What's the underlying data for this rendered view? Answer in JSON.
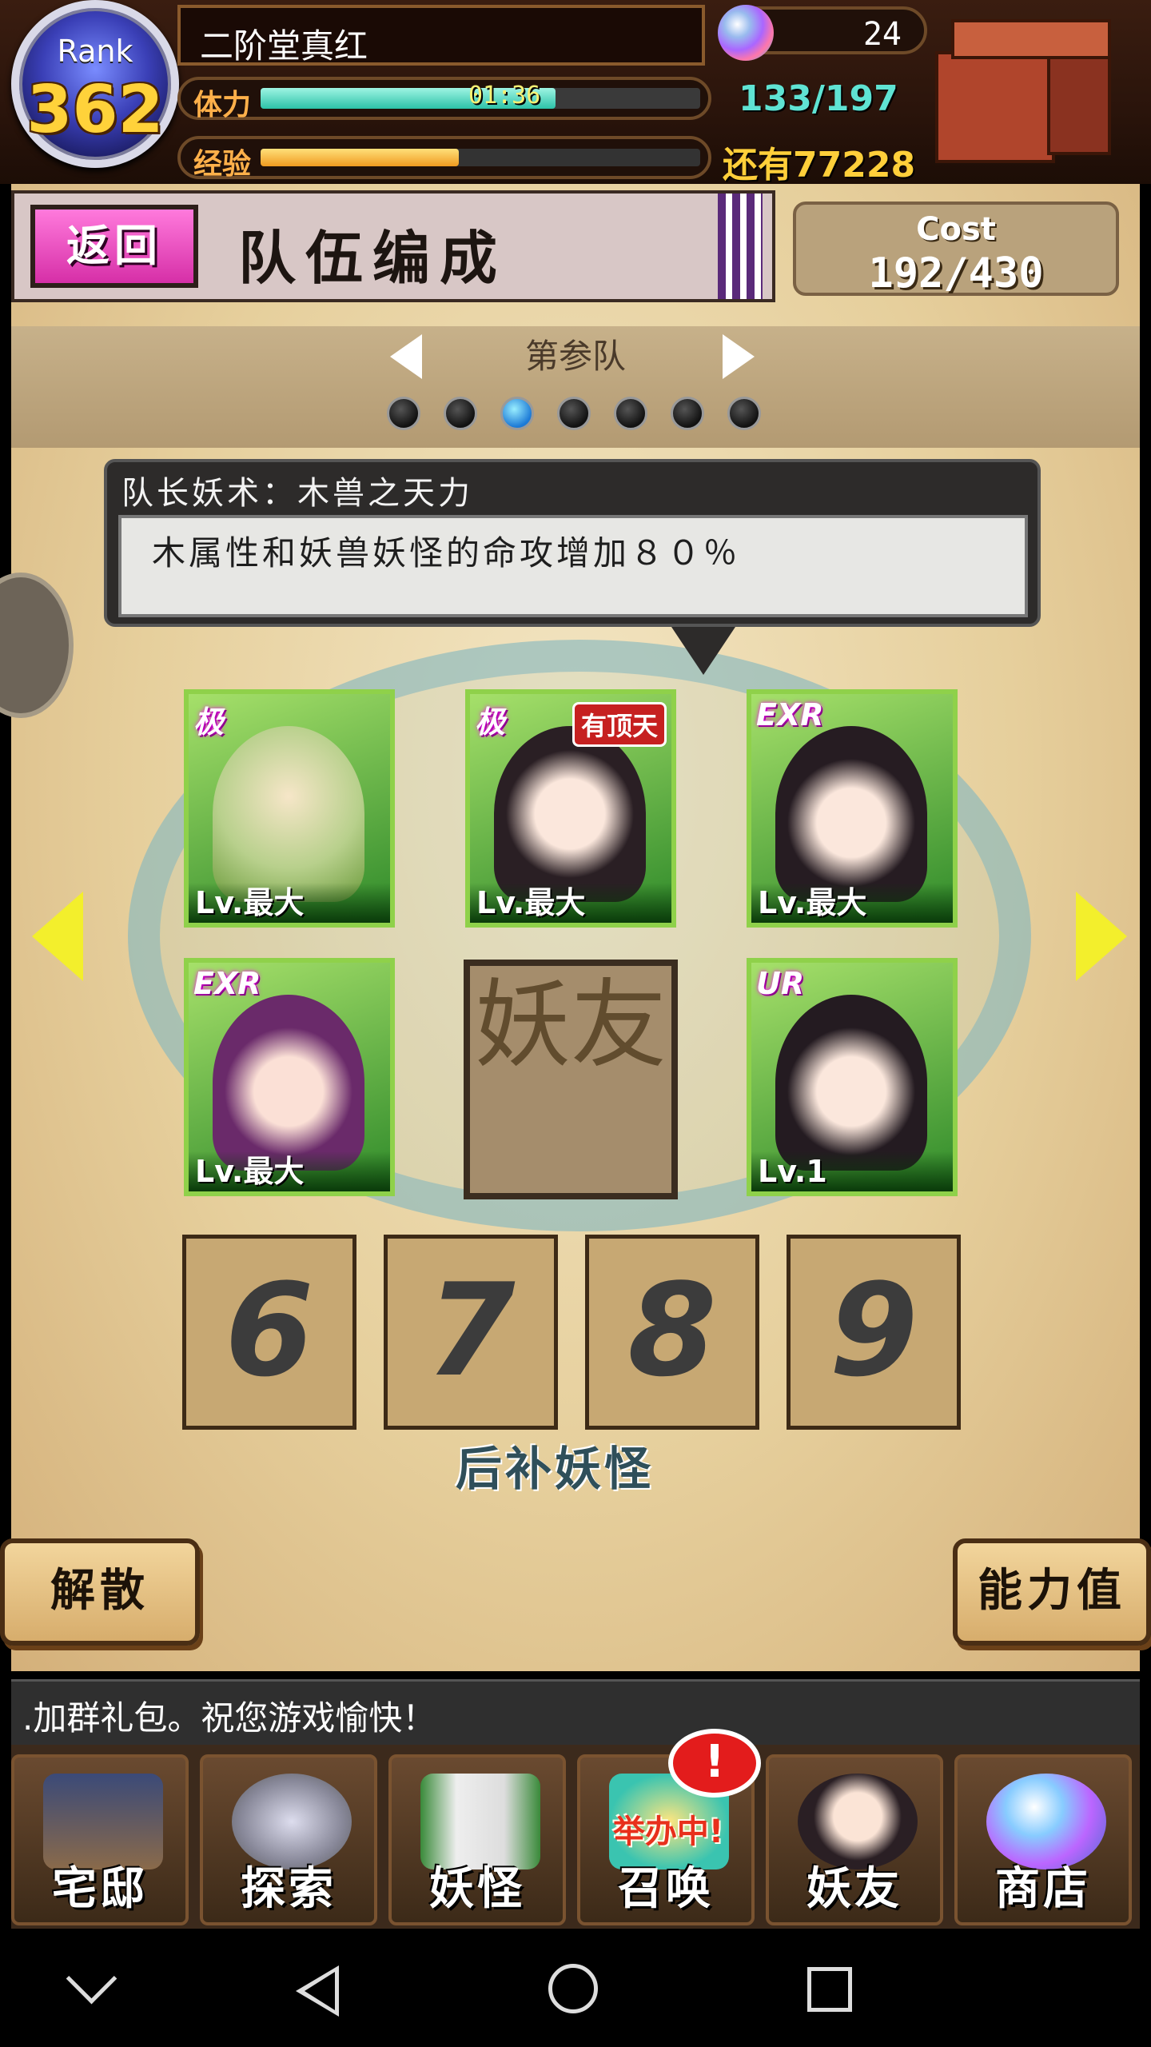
{
  "hud": {
    "rank_label": "Rank",
    "rank_value": "362",
    "player_name": "二阶堂真红",
    "stamina_label": "体力",
    "stamina_timer": "01:36",
    "stamina_count": "133/197",
    "stamina_fraction": 0.67,
    "exp_label": "经验",
    "exp_remaining": "还有77228",
    "exp_fraction": 0.45,
    "gem_count": "24"
  },
  "header": {
    "back_label": "返回",
    "title": "队伍编成",
    "cost_label": "Cost",
    "cost_value": "192/430"
  },
  "team": {
    "name": "第参队",
    "dot_count": 7,
    "active_index": 2
  },
  "leader_skill": {
    "title": "队长妖术：木兽之天力",
    "description": "木属性和妖兽妖怪的命攻增加８０％"
  },
  "cards": [
    {
      "rarity": "极",
      "level": "Lv.最大",
      "tag": ""
    },
    {
      "rarity": "极",
      "level": "Lv.最大",
      "tag": "有顶天"
    },
    {
      "rarity": "EXR",
      "level": "Lv.最大",
      "tag": ""
    },
    {
      "rarity": "EXR",
      "level": "Lv.最大",
      "tag": ""
    },
    {
      "rarity": "UR",
      "level": "Lv.1",
      "tag": ""
    }
  ],
  "friend_slot_text": "妖友",
  "sub_slots": [
    "6",
    "7",
    "8",
    "9"
  ],
  "sub_label": "后补妖怪",
  "buttons": {
    "disband": "解散",
    "stats": "能力值"
  },
  "ticker": ".加群礼包。祝您游戏愉快！",
  "nav": [
    {
      "label": "宅邸",
      "icon": "mansion-icon"
    },
    {
      "label": "探索",
      "icon": "magnifier-icon"
    },
    {
      "label": "妖怪",
      "icon": "scroll-icon"
    },
    {
      "label": "召唤",
      "icon": "summon-star-icon",
      "tag": "举办中!"
    },
    {
      "label": "妖友",
      "icon": "friend-girl-icon"
    },
    {
      "label": "商店",
      "icon": "shop-orb-icon"
    }
  ],
  "event_badge": "!",
  "colors": {
    "stamina": "#2cc2a8",
    "exp": "#f09a20",
    "back_button": "#d62fa7",
    "card_border": "#8fd14a"
  }
}
